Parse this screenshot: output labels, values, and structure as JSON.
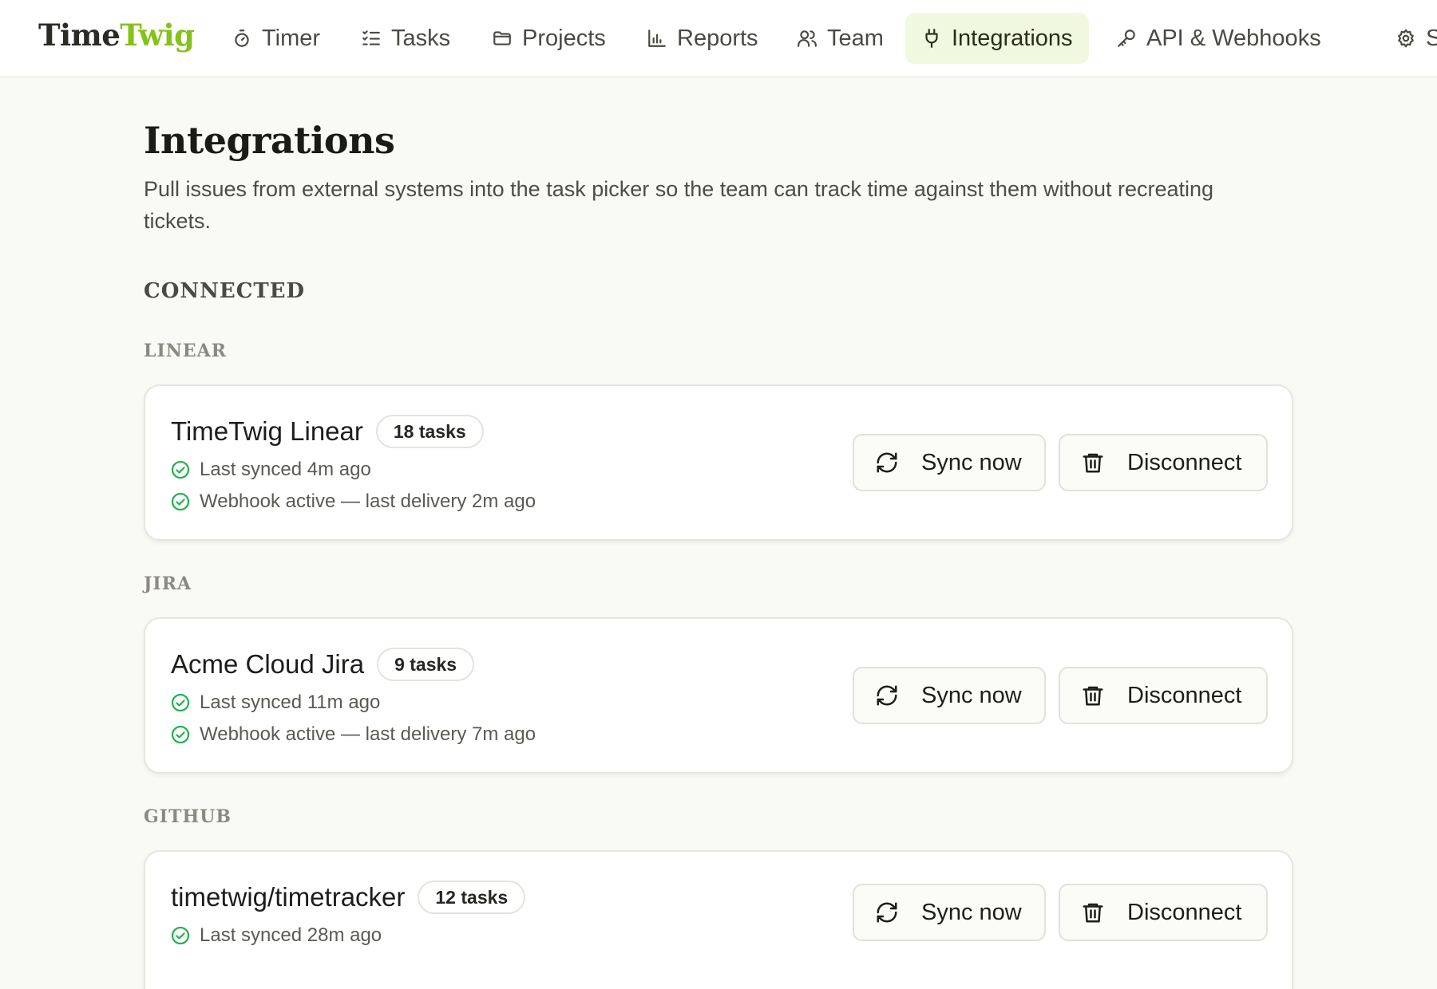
{
  "app": {
    "logo_part1": "Time",
    "logo_part2": "Twig",
    "accent": "#84c21a"
  },
  "nav": {
    "items": [
      {
        "label": "Timer",
        "icon": "stopwatch-icon"
      },
      {
        "label": "Tasks",
        "icon": "checklist-icon"
      },
      {
        "label": "Projects",
        "icon": "folder-icon"
      },
      {
        "label": "Reports",
        "icon": "bar-chart-icon"
      },
      {
        "label": "Team",
        "icon": "users-icon"
      },
      {
        "label": "Integrations",
        "icon": "plug-icon",
        "active": true
      },
      {
        "label": "API & Webhooks",
        "icon": "key-icon"
      },
      {
        "label": "S",
        "icon": "gear-icon"
      }
    ]
  },
  "page": {
    "title": "Integrations",
    "description": "Pull issues from external systems into the task picker so the team can track time against them without recreating tickets.",
    "section_label": "CONNECTED"
  },
  "integrations": [
    {
      "group": "LINEAR",
      "name": "TimeTwig Linear",
      "badge": "18 tasks",
      "statuses": [
        "Last synced 4m ago",
        "Webhook active — last delivery 2m ago"
      ],
      "sync_label": "Sync now",
      "disconnect_label": "Disconnect"
    },
    {
      "group": "JIRA",
      "name": "Acme Cloud Jira",
      "badge": "9 tasks",
      "statuses": [
        "Last synced 11m ago",
        "Webhook active — last delivery 7m ago"
      ],
      "sync_label": "Sync now",
      "disconnect_label": "Disconnect"
    },
    {
      "group": "GITHUB",
      "name": "timetwig/timetracker",
      "badge": "12 tasks",
      "statuses": [
        "Last synced 28m ago"
      ],
      "sync_label": "Sync now",
      "disconnect_label": "Disconnect"
    }
  ],
  "colors": {
    "status_ok": "#22b24c",
    "active_tab_bg": "#f0f8df"
  }
}
